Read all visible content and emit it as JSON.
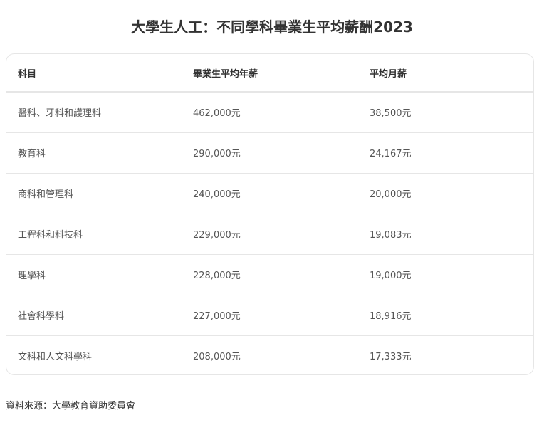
{
  "title": "大學生人工：不同學科畢業生平均薪酬2023",
  "chart_data": {
    "type": "table",
    "title": "大學生人工：不同學科畢業生平均薪酬2023",
    "columns": [
      "科目",
      "畢業生平均年薪",
      "平均月薪"
    ],
    "rows": [
      [
        "醫科、牙科和護理科",
        "462,000元",
        "38,500元"
      ],
      [
        "教育科",
        "290,000元",
        "24,167元"
      ],
      [
        "商科和管理科",
        "240,000元",
        "20,000元"
      ],
      [
        "工程科和科技科",
        "229,000元",
        "19,083元"
      ],
      [
        "理學科",
        "228,000元",
        "19,000元"
      ],
      [
        "社會科學科",
        "227,000元",
        "18,916元"
      ],
      [
        "文科和人文科學科",
        "208,000元",
        "17,333元"
      ]
    ],
    "source": "資料來源：大學教育資助委員會"
  }
}
